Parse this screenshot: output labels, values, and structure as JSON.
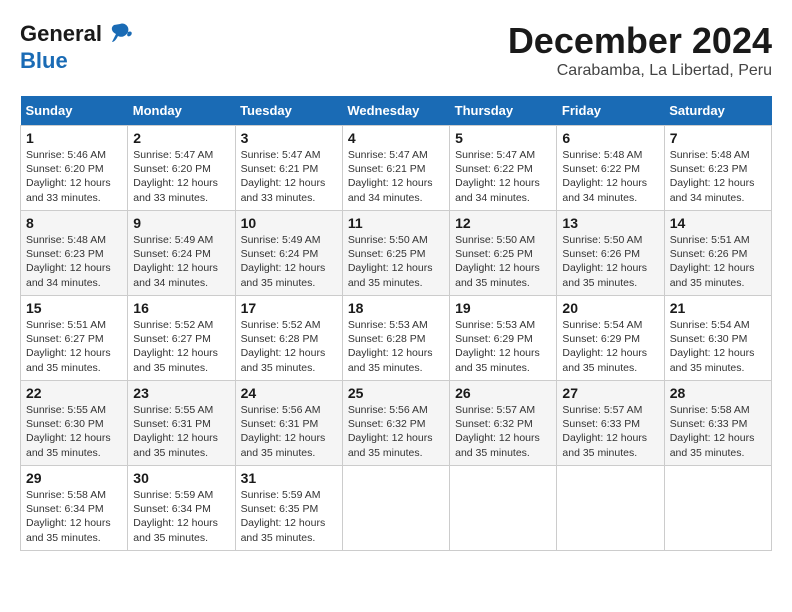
{
  "logo": {
    "text_general": "General",
    "text_blue": "Blue",
    "icon": "🐦"
  },
  "header": {
    "month": "December 2024",
    "location": "Carabamba, La Libertad, Peru"
  },
  "weekdays": [
    "Sunday",
    "Monday",
    "Tuesday",
    "Wednesday",
    "Thursday",
    "Friday",
    "Saturday"
  ],
  "weeks": [
    [
      {
        "day": "1",
        "sunrise": "5:46 AM",
        "sunset": "6:20 PM",
        "daylight": "12 hours and 33 minutes."
      },
      {
        "day": "2",
        "sunrise": "5:47 AM",
        "sunset": "6:20 PM",
        "daylight": "12 hours and 33 minutes."
      },
      {
        "day": "3",
        "sunrise": "5:47 AM",
        "sunset": "6:21 PM",
        "daylight": "12 hours and 33 minutes."
      },
      {
        "day": "4",
        "sunrise": "5:47 AM",
        "sunset": "6:21 PM",
        "daylight": "12 hours and 34 minutes."
      },
      {
        "day": "5",
        "sunrise": "5:47 AM",
        "sunset": "6:22 PM",
        "daylight": "12 hours and 34 minutes."
      },
      {
        "day": "6",
        "sunrise": "5:48 AM",
        "sunset": "6:22 PM",
        "daylight": "12 hours and 34 minutes."
      },
      {
        "day": "7",
        "sunrise": "5:48 AM",
        "sunset": "6:23 PM",
        "daylight": "12 hours and 34 minutes."
      }
    ],
    [
      {
        "day": "8",
        "sunrise": "5:48 AM",
        "sunset": "6:23 PM",
        "daylight": "12 hours and 34 minutes."
      },
      {
        "day": "9",
        "sunrise": "5:49 AM",
        "sunset": "6:24 PM",
        "daylight": "12 hours and 34 minutes."
      },
      {
        "day": "10",
        "sunrise": "5:49 AM",
        "sunset": "6:24 PM",
        "daylight": "12 hours and 35 minutes."
      },
      {
        "day": "11",
        "sunrise": "5:50 AM",
        "sunset": "6:25 PM",
        "daylight": "12 hours and 35 minutes."
      },
      {
        "day": "12",
        "sunrise": "5:50 AM",
        "sunset": "6:25 PM",
        "daylight": "12 hours and 35 minutes."
      },
      {
        "day": "13",
        "sunrise": "5:50 AM",
        "sunset": "6:26 PM",
        "daylight": "12 hours and 35 minutes."
      },
      {
        "day": "14",
        "sunrise": "5:51 AM",
        "sunset": "6:26 PM",
        "daylight": "12 hours and 35 minutes."
      }
    ],
    [
      {
        "day": "15",
        "sunrise": "5:51 AM",
        "sunset": "6:27 PM",
        "daylight": "12 hours and 35 minutes."
      },
      {
        "day": "16",
        "sunrise": "5:52 AM",
        "sunset": "6:27 PM",
        "daylight": "12 hours and 35 minutes."
      },
      {
        "day": "17",
        "sunrise": "5:52 AM",
        "sunset": "6:28 PM",
        "daylight": "12 hours and 35 minutes."
      },
      {
        "day": "18",
        "sunrise": "5:53 AM",
        "sunset": "6:28 PM",
        "daylight": "12 hours and 35 minutes."
      },
      {
        "day": "19",
        "sunrise": "5:53 AM",
        "sunset": "6:29 PM",
        "daylight": "12 hours and 35 minutes."
      },
      {
        "day": "20",
        "sunrise": "5:54 AM",
        "sunset": "6:29 PM",
        "daylight": "12 hours and 35 minutes."
      },
      {
        "day": "21",
        "sunrise": "5:54 AM",
        "sunset": "6:30 PM",
        "daylight": "12 hours and 35 minutes."
      }
    ],
    [
      {
        "day": "22",
        "sunrise": "5:55 AM",
        "sunset": "6:30 PM",
        "daylight": "12 hours and 35 minutes."
      },
      {
        "day": "23",
        "sunrise": "5:55 AM",
        "sunset": "6:31 PM",
        "daylight": "12 hours and 35 minutes."
      },
      {
        "day": "24",
        "sunrise": "5:56 AM",
        "sunset": "6:31 PM",
        "daylight": "12 hours and 35 minutes."
      },
      {
        "day": "25",
        "sunrise": "5:56 AM",
        "sunset": "6:32 PM",
        "daylight": "12 hours and 35 minutes."
      },
      {
        "day": "26",
        "sunrise": "5:57 AM",
        "sunset": "6:32 PM",
        "daylight": "12 hours and 35 minutes."
      },
      {
        "day": "27",
        "sunrise": "5:57 AM",
        "sunset": "6:33 PM",
        "daylight": "12 hours and 35 minutes."
      },
      {
        "day": "28",
        "sunrise": "5:58 AM",
        "sunset": "6:33 PM",
        "daylight": "12 hours and 35 minutes."
      }
    ],
    [
      {
        "day": "29",
        "sunrise": "5:58 AM",
        "sunset": "6:34 PM",
        "daylight": "12 hours and 35 minutes."
      },
      {
        "day": "30",
        "sunrise": "5:59 AM",
        "sunset": "6:34 PM",
        "daylight": "12 hours and 35 minutes."
      },
      {
        "day": "31",
        "sunrise": "5:59 AM",
        "sunset": "6:35 PM",
        "daylight": "12 hours and 35 minutes."
      },
      null,
      null,
      null,
      null
    ]
  ]
}
